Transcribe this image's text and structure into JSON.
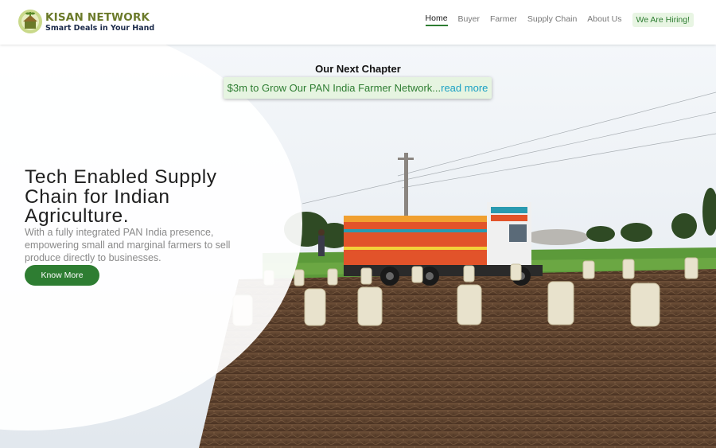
{
  "header": {
    "brand_name": "KISAN NETWORK",
    "brand_tagline": "Smart Deals in Your Hand",
    "nav": [
      {
        "label": "Home",
        "active": true
      },
      {
        "label": "Buyer",
        "active": false
      },
      {
        "label": "Farmer",
        "active": false
      },
      {
        "label": "Supply Chain",
        "active": false
      },
      {
        "label": "About Us",
        "active": false
      }
    ],
    "cta_label": "We Are Hiring!"
  },
  "announcement": {
    "title": "Our Next Chapter",
    "text": "$3m to Grow Our PAN India Farmer Network...",
    "link_label": "read more"
  },
  "hero": {
    "heading": "Tech Enabled Supply Chain for Indian Agriculture.",
    "subtext": "With a fully integrated PAN India presence, empowering small and marginal farmers to sell produce directly to businesses.",
    "button_label": "Know More"
  },
  "colors": {
    "brand_green": "#2e7d32",
    "brand_olive": "#6b7a2a",
    "link_blue": "#1aa0c4",
    "pill_bg": "#e6f4e1"
  },
  "icons": {
    "logo": "kisan-network-logo-icon",
    "hero_image": "truck-field-sacks-photo"
  }
}
